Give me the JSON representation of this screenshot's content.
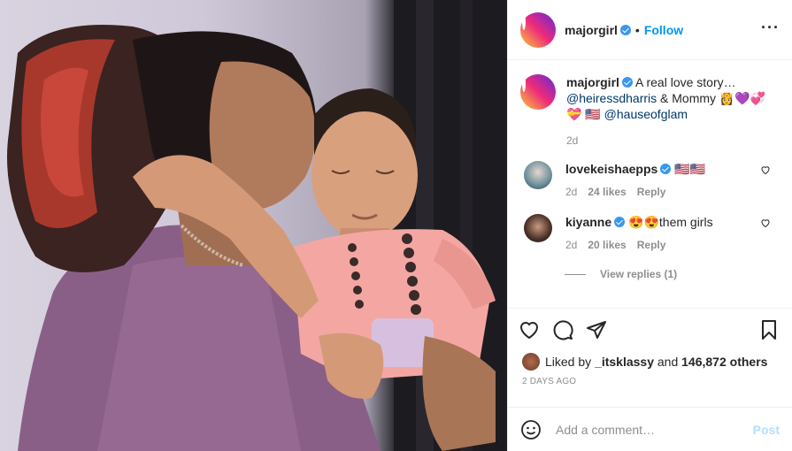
{
  "post": {
    "username": "majorgirl",
    "follow_label": "Follow",
    "dot": "•",
    "more_label": "···"
  },
  "caption": {
    "username": "majorgirl",
    "text_1": "A real love story…",
    "mention_1": "@heiressdharris",
    "text_2": "& Mommy",
    "emoji_1": "👸💜💞",
    "emoji_2": "💝",
    "emoji_3": "🇺🇸",
    "mention_2": "@hauseofglam",
    "age": "2d"
  },
  "comments": [
    {
      "username": "lovekeishaepps",
      "text": "🇺🇸🇺🇸",
      "age": "2d",
      "likes": "24 likes",
      "reply": "Reply"
    },
    {
      "username": "kiyanne",
      "text": "😍😍them girls",
      "age": "2d",
      "likes": "20 likes",
      "reply": "Reply"
    }
  ],
  "view_replies": "View replies (1)",
  "likes": {
    "prefix": "Liked by",
    "user": "_itsklassy",
    "and": "and",
    "count": "146,872 others"
  },
  "timestamp": "2 DAYS AGO",
  "add_comment": {
    "placeholder": "Add a comment…",
    "post_label": "Post"
  },
  "colors": {
    "accent": "#0095f6",
    "verified": "#3897f0",
    "muted": "#8e8e8e",
    "post_disabled": "#b2dffc"
  }
}
